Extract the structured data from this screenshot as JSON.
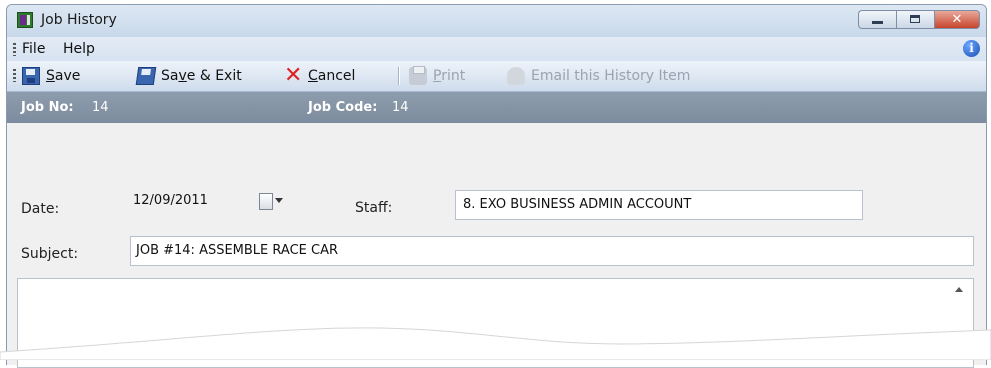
{
  "window": {
    "title": "Job History",
    "controls": {
      "close_glyph": "✕"
    }
  },
  "menu": {
    "items": [
      "File",
      "Help"
    ],
    "info_glyph": "i"
  },
  "toolbar": {
    "save": {
      "pre": "",
      "underline": "S",
      "post": "ave"
    },
    "save_exit": {
      "pre": "Sa",
      "underline": "v",
      "post": "e & Exit"
    },
    "cancel": {
      "pre": "",
      "underline": "C",
      "post": "ancel"
    },
    "print": {
      "pre": "",
      "underline": "P",
      "post": "rint",
      "disabled": true
    },
    "email": {
      "label": "Email this History Item",
      "disabled": true
    },
    "cancel_glyph": "✕"
  },
  "job": {
    "no_label": "Job No:",
    "no_value": "14",
    "code_label": "Job Code:",
    "code_value": "14"
  },
  "form": {
    "date_label": "Date:",
    "date_value": "12/09/2011",
    "staff_label": "Staff:",
    "staff_value": "8. EXO BUSINESS ADMIN ACCOUNT",
    "subject_label": "Subject:",
    "subject_value": "JOB #14: ASSEMBLE RACE CAR",
    "notes_value": ""
  },
  "colors": {
    "title_bar": "#c8d8ea",
    "job_bar": "#8696a8",
    "close_button": "#c7442c",
    "cancel_icon": "#dd2222"
  }
}
